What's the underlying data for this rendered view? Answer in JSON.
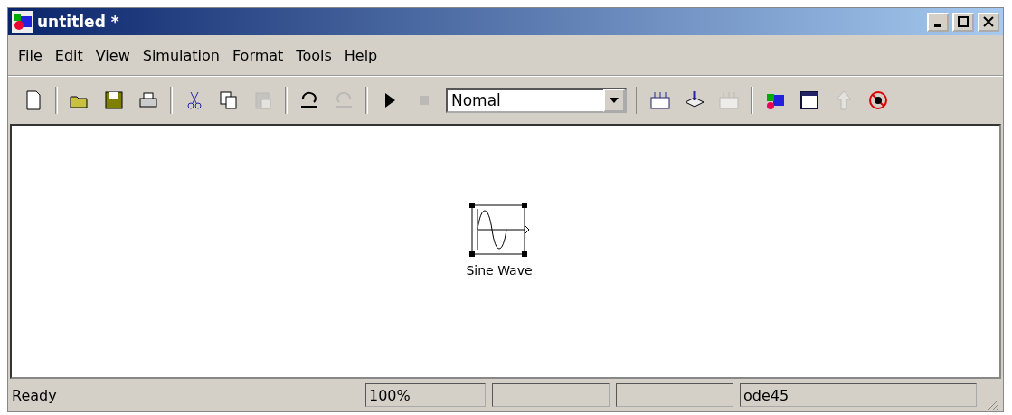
{
  "window": {
    "title": "untitled *"
  },
  "menu": [
    "File",
    "Edit",
    "View",
    "Simulation",
    "Format",
    "Tools",
    "Help"
  ],
  "toolbar": [
    {
      "kind": "new",
      "disabled": false
    },
    {
      "kind": "sep"
    },
    {
      "kind": "open",
      "disabled": false
    },
    {
      "kind": "save",
      "disabled": false
    },
    {
      "kind": "print",
      "disabled": false
    },
    {
      "kind": "sep"
    },
    {
      "kind": "cut",
      "disabled": false
    },
    {
      "kind": "copy",
      "disabled": false
    },
    {
      "kind": "paste",
      "disabled": true
    },
    {
      "kind": "sep"
    },
    {
      "kind": "undo",
      "disabled": false
    },
    {
      "kind": "redo",
      "disabled": true
    },
    {
      "kind": "sep"
    },
    {
      "kind": "play",
      "disabled": false
    },
    {
      "kind": "stop",
      "disabled": true
    },
    {
      "kind": "mode"
    },
    {
      "kind": "sep"
    },
    {
      "kind": "build",
      "disabled": false
    },
    {
      "kind": "update",
      "disabled": false
    },
    {
      "kind": "build",
      "disabled": true
    },
    {
      "kind": "sep"
    },
    {
      "kind": "library",
      "disabled": false
    },
    {
      "kind": "explorer",
      "disabled": false
    },
    {
      "kind": "up",
      "disabled": true
    },
    {
      "kind": "debug",
      "disabled": false
    }
  ],
  "mode_select": {
    "value": "Nomal"
  },
  "canvas": {
    "blocks": [
      {
        "label": "Sine Wave",
        "selected": true
      }
    ]
  },
  "status_bar": {
    "message": "Ready",
    "zoom": "100%",
    "solver": "ode45"
  }
}
